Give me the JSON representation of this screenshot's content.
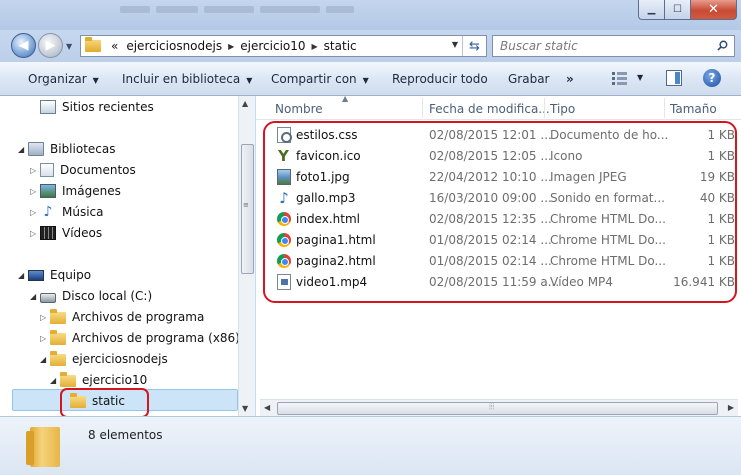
{
  "window": {
    "minimize_glyph": "▁",
    "maximize_glyph": "☐",
    "close_glyph": "✕"
  },
  "address_bar": {
    "overflow": "«",
    "breadcrumbs": [
      "ejerciciosnodejs",
      "ejercicio10",
      "static"
    ]
  },
  "search": {
    "placeholder": "Buscar static"
  },
  "toolbar": {
    "organize": "Organizar",
    "include_library": "Incluir en biblioteca",
    "share_with": "Compartir con",
    "play_all": "Reproducir todo",
    "burn": "Grabar",
    "more": "»",
    "help": "?"
  },
  "navigation": {
    "recent": "Sitios recientes",
    "libraries": "Bibliotecas",
    "documents": "Documentos",
    "images": "Imágenes",
    "music": "Música",
    "videos": "Vídeos",
    "computer": "Equipo",
    "local_disk": "Disco local (C:)",
    "program_files": "Archivos de programa",
    "program_files_x86": "Archivos de programa (x86)",
    "ejerciciosnodejs": "ejerciciosnodejs",
    "ejercicio10": "ejercicio10",
    "static": "static"
  },
  "columns": {
    "name": "Nombre",
    "date": "Fecha de modifica...",
    "type": "Tipo",
    "size": "Tamaño"
  },
  "files": [
    {
      "name": "estilos.css",
      "date": "02/08/2015 12:01 ...",
      "type": "Documento de ho...",
      "size": "1 KB",
      "icon": "css-file-icon"
    },
    {
      "name": "favicon.ico",
      "date": "02/08/2015 12:05 ...",
      "type": "Icono",
      "size": "1 KB",
      "icon": "ico-file-icon"
    },
    {
      "name": "foto1.jpg",
      "date": "22/04/2012 10:10 ...",
      "type": "Imagen JPEG",
      "size": "19 KB",
      "icon": "jpg-file-icon"
    },
    {
      "name": "gallo.mp3",
      "date": "16/03/2010 09:00 ...",
      "type": "Sonido en format...",
      "size": "40 KB",
      "icon": "mp3-file-icon"
    },
    {
      "name": "index.html",
      "date": "02/08/2015 12:35 ...",
      "type": "Chrome HTML Do...",
      "size": "1 KB",
      "icon": "chrome-html-icon"
    },
    {
      "name": "pagina1.html",
      "date": "01/08/2015 02:14 ...",
      "type": "Chrome HTML Do...",
      "size": "1 KB",
      "icon": "chrome-html-icon"
    },
    {
      "name": "pagina2.html",
      "date": "01/08/2015 02:14 ...",
      "type": "Chrome HTML Do...",
      "size": "1 KB",
      "icon": "chrome-html-icon"
    },
    {
      "name": "video1.mp4",
      "date": "02/08/2015 11:59 a...",
      "type": "Vídeo MP4",
      "size": "16.941 KB",
      "icon": "mp4-file-icon"
    }
  ],
  "details": {
    "item_count": "8 elementos"
  },
  "colors": {
    "annotation_red": "#d4171e",
    "selection": "#cce4f7"
  }
}
